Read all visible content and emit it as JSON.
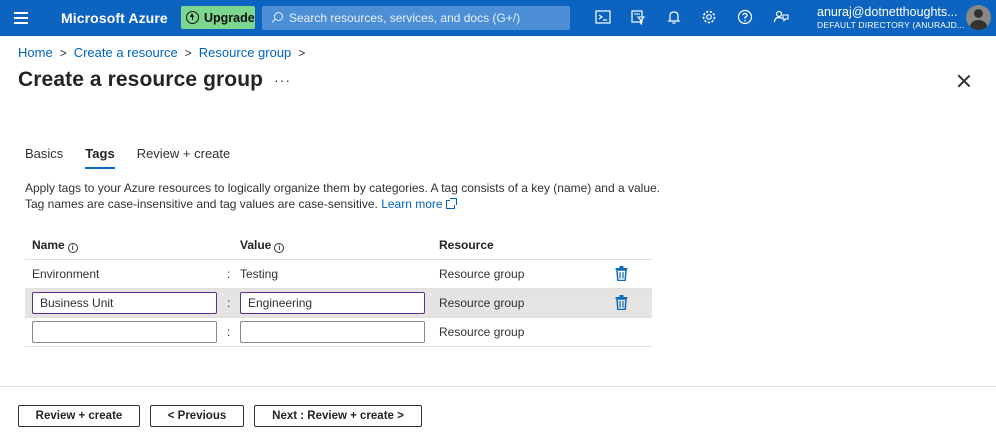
{
  "topbar": {
    "brand": "Microsoft Azure",
    "upgrade_label": "Upgrade",
    "search_placeholder": "Search resources, services, and docs (G+/)",
    "user_name": "anuraj@dotnetthoughts...",
    "user_directory": "DEFAULT DIRECTORY (ANURAJD...",
    "icons": [
      "cloud-shell-icon",
      "directory-filter-icon",
      "notifications-icon",
      "settings-icon",
      "help-icon",
      "feedback-icon"
    ]
  },
  "breadcrumb": {
    "items": [
      "Home",
      "Create a resource",
      "Resource group"
    ]
  },
  "page": {
    "title": "Create a resource group",
    "more": "···"
  },
  "tabs": [
    {
      "label": "Basics",
      "active": false
    },
    {
      "label": "Tags",
      "active": true
    },
    {
      "label": "Review + create",
      "active": false
    }
  ],
  "description": {
    "line1": "Apply tags to your Azure resources to logically organize them by categories. A tag consists of a key (name) and a value.",
    "line2": "Tag names are case-insensitive and tag values are case-sensitive.",
    "learn_more": "Learn more"
  },
  "table": {
    "headers": {
      "name": "Name",
      "value": "Value",
      "resource": "Resource"
    },
    "rows": [
      {
        "name": "Environment",
        "value": "Testing",
        "resource": "Resource group"
      },
      {
        "name": "Business Unit",
        "value": "Engineering",
        "resource": "Resource group"
      },
      {
        "name": "",
        "value": "",
        "resource": "Resource group"
      }
    ],
    "separator": ":"
  },
  "footer": {
    "review_create": "Review + create",
    "previous": "< Previous",
    "next": "Next : Review + create >"
  },
  "colors": {
    "topbar": "#0c64c0",
    "upgrade": "#7dd68e",
    "link": "#0064bf",
    "focus_border": "#5c2d91",
    "trash": "#0f6cbd"
  }
}
